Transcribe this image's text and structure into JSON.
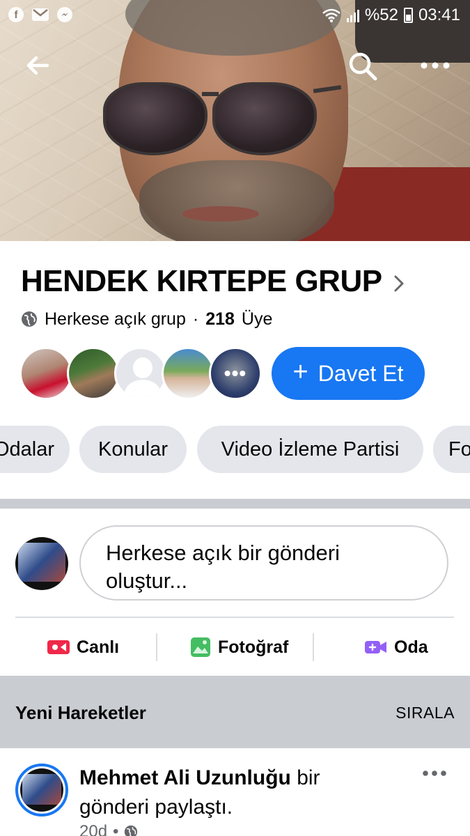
{
  "status_bar": {
    "battery": "%52",
    "time": "03:41",
    "notification_icons": [
      "facebook-icon",
      "mail-icon",
      "messenger-icon"
    ]
  },
  "nav": {
    "icons": [
      "back-arrow-icon",
      "search-icon",
      "more-dots-icon"
    ]
  },
  "group": {
    "name": "HENDEK KIRTEPE GRUP",
    "privacy": "Herkese açık grup",
    "separator": "·",
    "member_count": "218",
    "member_label": "Üye",
    "member_overflow": "•••",
    "invite_plus": "+",
    "invite_label": "Davet Et"
  },
  "tabs": [
    "Odalar",
    "Konular",
    "Video İzleme Partisi",
    "Fotoğraflar"
  ],
  "composer": {
    "placeholder": "Herkese açık bir gönderi oluştur..."
  },
  "composer_actions": {
    "live": "Canlı",
    "photo": "Fotoğraf",
    "room": "Oda"
  },
  "activity": {
    "title": "Yeni Hareketler",
    "sort": "SIRALA"
  },
  "post": {
    "author": "Mehmet Ali Uzunluğu",
    "action": " bir gönderi paylaştı.",
    "time": "20d",
    "dot": "•"
  },
  "colors": {
    "accent": "#1877f2",
    "chip_bg": "#e4e6eb",
    "section_bg": "#c9ccd1",
    "live_red": "#f02849",
    "photo_green": "#45bd62",
    "room_purple": "#9360f7"
  }
}
